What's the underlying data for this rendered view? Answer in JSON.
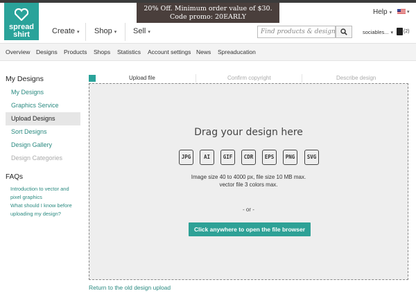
{
  "logo": {
    "line1": "spread",
    "line2": "shirt"
  },
  "promo": {
    "line1": "20% Off. Minimum order value of $30.",
    "line2": "Code promo: 20EARLY"
  },
  "header": {
    "help_label": "Help",
    "nav": [
      {
        "label": "Create"
      },
      {
        "label": "Shop"
      },
      {
        "label": "Sell"
      }
    ],
    "search_placeholder": "Find products & designs",
    "username": "sociables...",
    "cart_count": "(2)"
  },
  "subnav": [
    "Overview",
    "Designs",
    "Products",
    "Shops",
    "Statistics",
    "Account settings",
    "News",
    "Spreaducation"
  ],
  "sidebar": {
    "title": "My Designs",
    "items": [
      {
        "label": "My Designs",
        "state": "link"
      },
      {
        "label": "Graphics Service",
        "state": "link"
      },
      {
        "label": "Upload Designs",
        "state": "active"
      },
      {
        "label": "Sort Designs",
        "state": "link"
      },
      {
        "label": "Design Gallery",
        "state": "link"
      },
      {
        "label": "Design Categories",
        "state": "disabled"
      }
    ],
    "faq_title": "FAQs",
    "faq_links": [
      {
        "line1": "Introduction to vector and",
        "line2": "pixel graphics"
      },
      {
        "line1": "What should I know before",
        "line2": "uploading my design?"
      }
    ]
  },
  "steps": [
    {
      "label": "Upload file",
      "state": "current"
    },
    {
      "label": "Confirm copyright",
      "state": "pending"
    },
    {
      "label": "Describe design",
      "state": "pending"
    }
  ],
  "upload": {
    "heading": "Drag your design here",
    "formats": [
      "JPG",
      "AI",
      "GIF",
      "CDR",
      "EPS",
      "PNG",
      "SVG"
    ],
    "info_line1": "Image size 40 to 4000 px, file size 10 MB max.",
    "info_line2": "vector file 3 colors max.",
    "or_text": "- or -",
    "browse_label": "Click anywhere to open the file browser"
  },
  "old_upload_link": "Return to the old design upload",
  "colors": {
    "brand": "#2aa39a",
    "promo_bg": "#4a3f3c"
  }
}
